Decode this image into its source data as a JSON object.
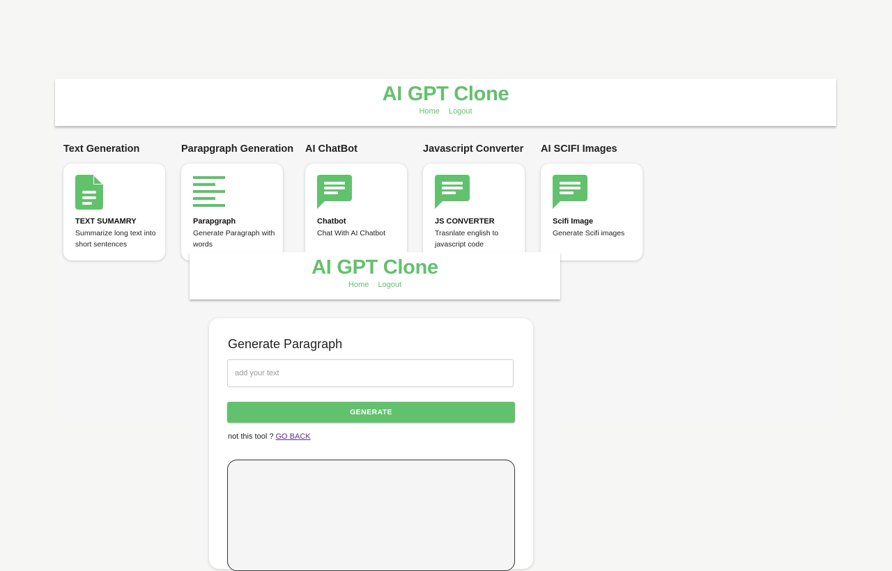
{
  "back_window": {
    "brand": "AI GPT Clone",
    "nav": {
      "home": "Home",
      "logout": "Logout"
    },
    "tools": [
      {
        "heading": "Text Generation",
        "icon": "document-icon",
        "title": "TEXT SUMAMRY",
        "description": "Summarize long text into short sentences"
      },
      {
        "heading": "Parapgraph Generation",
        "icon": "paragraph-lines-icon",
        "title": "Parapgraph",
        "description": "Generate Paragraph with words"
      },
      {
        "heading": "AI ChatBot",
        "icon": "chat-bubble-icon",
        "title": "Chatbot",
        "description": "Chat With AI Chatbot"
      },
      {
        "heading": "Javascript Converter",
        "icon": "chat-bubble-icon",
        "title": "JS CONVERTER",
        "description": "Trasnlate english to javascript code"
      },
      {
        "heading": "AI SCIFI Images",
        "icon": "chat-bubble-icon",
        "title": "Scifi Image",
        "description": "Generate Scifi images"
      }
    ]
  },
  "front_window": {
    "brand": "AI GPT Clone",
    "nav": {
      "home": "Home",
      "logout": "Logout"
    },
    "form": {
      "title": "Generate Paragraph",
      "input_placeholder": "add your text",
      "input_value": "",
      "button_label": "GENERATE",
      "back_prefix": "not this tool ?",
      "back_link": "GO BACK"
    }
  },
  "colors": {
    "accent": "#62c16d",
    "link_visited": "#5b2e8c"
  }
}
